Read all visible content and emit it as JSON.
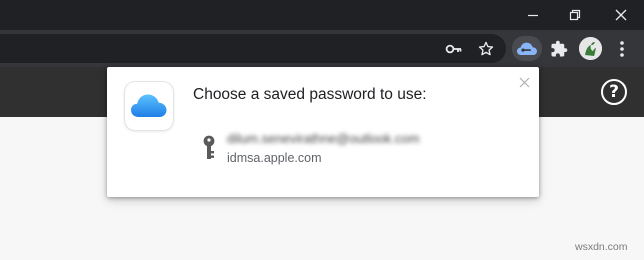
{
  "popup": {
    "title": "Choose a saved password to use:",
    "credential": {
      "username": "dilum.senevirathne@outlook.com",
      "domain": "idmsa.apple.com"
    }
  },
  "page": {
    "help_glyph": "?"
  },
  "watermark": "wsxdn.com",
  "icons": {
    "window_controls": [
      "minimize-icon",
      "restore-icon",
      "close-icon"
    ],
    "toolbar": [
      "key-icon",
      "star-icon",
      "icloud-extension-icon",
      "puzzle-icon",
      "avatar",
      "more-icon"
    ],
    "popup": [
      "icloud-icon",
      "close-icon",
      "key-icon"
    ]
  },
  "colors": {
    "titlebar": "#202124",
    "toolbar": "#35363a",
    "page_header": "#303030",
    "icloud_blue": "#2e9bf0"
  }
}
